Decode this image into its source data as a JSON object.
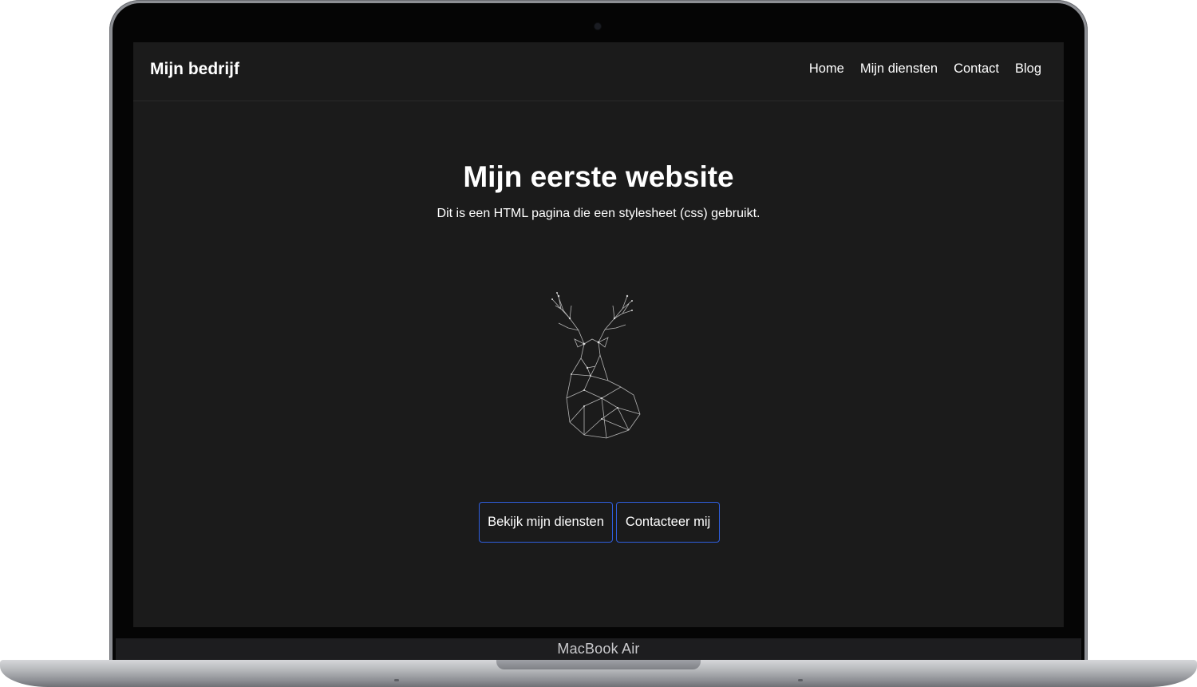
{
  "device": {
    "model_label": "MacBook Air"
  },
  "navbar": {
    "brand": "Mijn bedrijf",
    "links": [
      "Home",
      "Mijn diensten",
      "Contact",
      "Blog"
    ]
  },
  "hero": {
    "title": "Mijn eerste website",
    "subtitle": "Dit is een HTML pagina die een stylesheet (css) gebruikt.",
    "image": "deer-low-poly-wireframe-illustration",
    "buttons": [
      "Bekijk mijn diensten",
      "Contacteer mij"
    ]
  },
  "colors": {
    "page_background": "#1b1b1b",
    "text": "#ffffff",
    "button_border": "#2f5fe0"
  }
}
